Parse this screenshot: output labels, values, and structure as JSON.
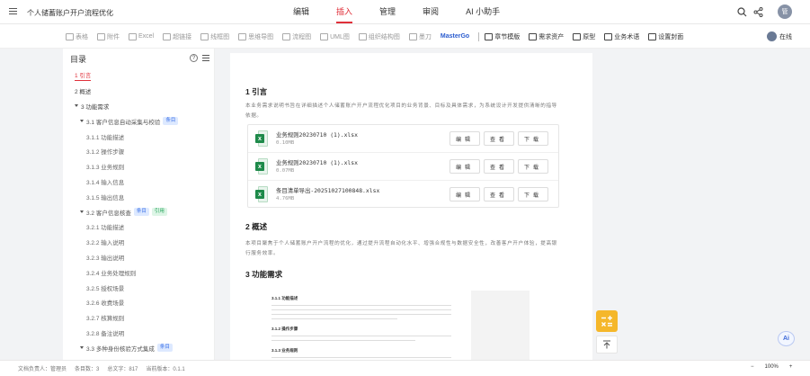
{
  "header": {
    "doc_title": "个人储蓄账户开户流程优化",
    "tabs": [
      "编辑",
      "插入",
      "管理",
      "审阅",
      "AI 小助手"
    ],
    "active_tab": "插入",
    "avatar_text": "管"
  },
  "toolbar": {
    "items": [
      "表格",
      "附件",
      "Excel",
      "超链接",
      "线框图",
      "思维导图",
      "流程图",
      "UML图",
      "组织结构图",
      "墨刀",
      "MasterGo",
      "章节模版",
      "需求资产",
      "原型",
      "业务术语",
      "设置封面"
    ],
    "online_label": "在线"
  },
  "sidebar": {
    "title": "目录",
    "items": [
      {
        "label": "1 引言",
        "level": 1,
        "active": true
      },
      {
        "label": "2 概述",
        "level": 1
      },
      {
        "label": "3 功能需求",
        "level": 1,
        "expanded": true
      },
      {
        "label": "3.1 客户信息自动采集与校验",
        "level": 2,
        "expanded": true,
        "tags": [
          "条目"
        ]
      },
      {
        "label": "3.1.1 功能描述",
        "level": 3
      },
      {
        "label": "3.1.2 操作步骤",
        "level": 3
      },
      {
        "label": "3.1.3 业务规则",
        "level": 3
      },
      {
        "label": "3.1.4 输入信息",
        "level": 3
      },
      {
        "label": "3.1.5 输出信息",
        "level": 3
      },
      {
        "label": "3.2 客户信息核查",
        "level": 2,
        "expanded": true,
        "tags": [
          "条目",
          "引用"
        ]
      },
      {
        "label": "3.2.1 功能描述",
        "level": 3
      },
      {
        "label": "3.2.2 输入说明",
        "level": 3
      },
      {
        "label": "3.2.3 输出说明",
        "level": 3
      },
      {
        "label": "3.2.4 业务处理规则",
        "level": 3
      },
      {
        "label": "3.2.5 授权场景",
        "level": 3
      },
      {
        "label": "3.2.6 收费场景",
        "level": 3
      },
      {
        "label": "3.2.7 核算规则",
        "level": 3
      },
      {
        "label": "3.2.8 备注说明",
        "level": 3
      },
      {
        "label": "3.3 多种身份核验方式集成",
        "level": 2,
        "expanded": true,
        "tags": [
          "条目"
        ]
      }
    ]
  },
  "document": {
    "sections": [
      {
        "heading": "1 引言",
        "text": "本业务需求说明书旨在详细描述个人储蓄账户开户流程优化项目的业务背景、目标及具体需求，为系统设计开发提供清晰的指导依据。"
      },
      {
        "heading": "2 概述",
        "text": "本项目聚焦于个人储蓄账户开户流程的优化，通过提升流程自动化水平、增强合规性与数据安全性，改善客户开户体验，提高银行服务效率。"
      },
      {
        "heading": "3 功能需求",
        "text": ""
      }
    ],
    "attachments": [
      {
        "name": "业务规则20230710 (1).xlsx",
        "size": "0.10MB"
      },
      {
        "name": "业务规则20230710 (1).xlsx",
        "size": "0.07MB"
      },
      {
        "name": "条目清单导出-20251027100848.xlsx",
        "size": "4.76MB"
      }
    ],
    "attachment_actions": [
      "编辑",
      "查看",
      "下载"
    ],
    "thumbnail_headings": [
      "3.1.1 功能描述",
      "3.1.2 操作步骤",
      "3.1.3 业务规则"
    ]
  },
  "statusbar": {
    "items": [
      "文档负责人：管理员",
      "条目数：3",
      "总文字：817",
      "当前版本：0.1.1"
    ],
    "zoom": "100%"
  },
  "colors": {
    "accent": "#e0303a",
    "tag_blue": "#3d72e8",
    "tag_green": "#24a35a",
    "float": "#f5b72a"
  }
}
